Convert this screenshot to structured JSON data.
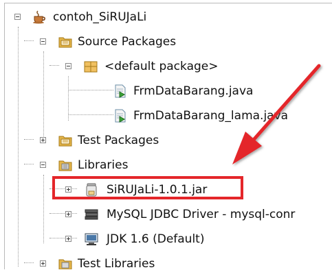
{
  "tree": {
    "items": [
      {
        "label": "contoh_SiRUJaLi",
        "icon": "project-coffee-icon",
        "expanded": true
      },
      {
        "label": "Source Packages",
        "icon": "source-folder-icon",
        "expanded": true
      },
      {
        "label": "<default package>",
        "icon": "package-icon",
        "expanded": true
      },
      {
        "label": "FrmDataBarang.java",
        "icon": "java-file-icon"
      },
      {
        "label": "FrmDataBarang_lama.java",
        "icon": "java-file-icon"
      },
      {
        "label": "Test Packages",
        "icon": "test-folder-icon",
        "expanded": false
      },
      {
        "label": "Libraries",
        "icon": "library-folder-icon",
        "expanded": true
      },
      {
        "label": "SiRUJaLi-1.0.1.jar",
        "icon": "jar-icon",
        "expanded": false
      },
      {
        "label": "MySQL JDBC Driver - mysql-conr",
        "icon": "books-icon",
        "expanded": false
      },
      {
        "label": "JDK 1.6 (Default)",
        "icon": "jdk-monitor-icon",
        "expanded": false
      },
      {
        "label": "Test Libraries",
        "icon": "test-library-folder-icon",
        "expanded": false
      }
    ]
  },
  "annotation": {
    "highlight_color": "#e4262a",
    "highlighted_item": "SiRUJaLi-1.0.1.jar"
  },
  "colors": {
    "folder": "#e5b64a",
    "text": "#111111"
  }
}
